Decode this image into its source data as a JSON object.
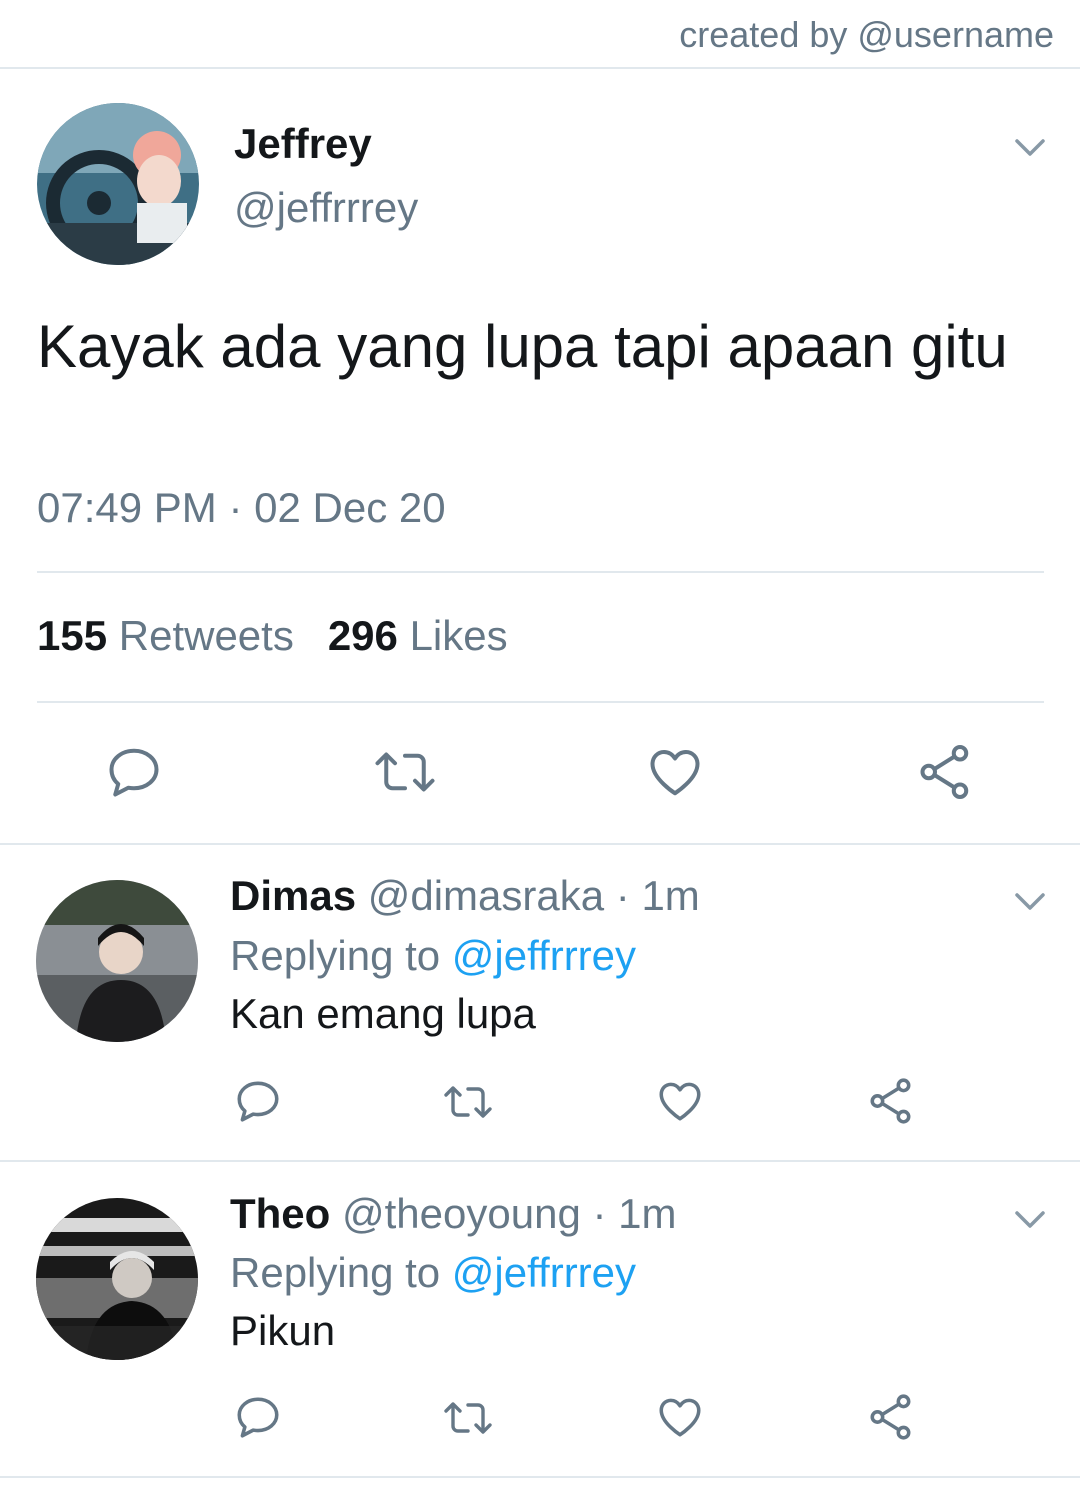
{
  "credit": "created by @username",
  "tweet": {
    "name": "Jeffrey",
    "handle": "@jeffrrrey",
    "text": "Kayak ada yang lupa tapi apaan gitu",
    "time": "07:49 PM",
    "separator": "·",
    "date": "02 Dec 20",
    "retweets_count": "155",
    "retweets_label": "Retweets",
    "likes_count": "296",
    "likes_label": "Likes"
  },
  "replies": [
    {
      "name": "Dimas",
      "handle": "@dimasraka",
      "dot": "·",
      "time": "1m",
      "replying_label": "Replying to",
      "replying_to": "@jeffrrrey",
      "text": "Kan emang lupa"
    },
    {
      "name": "Theo",
      "handle": "@theoyoung",
      "dot": "·",
      "time": "1m",
      "replying_label": "Replying to",
      "replying_to": "@jeffrrrey",
      "text": "Pikun"
    }
  ],
  "icons": {
    "reply": "reply-icon",
    "retweet": "retweet-icon",
    "like": "heart-icon",
    "share": "share-icon",
    "more": "chevron-down-icon"
  },
  "colors": {
    "text": "#14171a",
    "secondary": "#657786",
    "link": "#1da1f2",
    "divider": "#e1e8ed"
  }
}
